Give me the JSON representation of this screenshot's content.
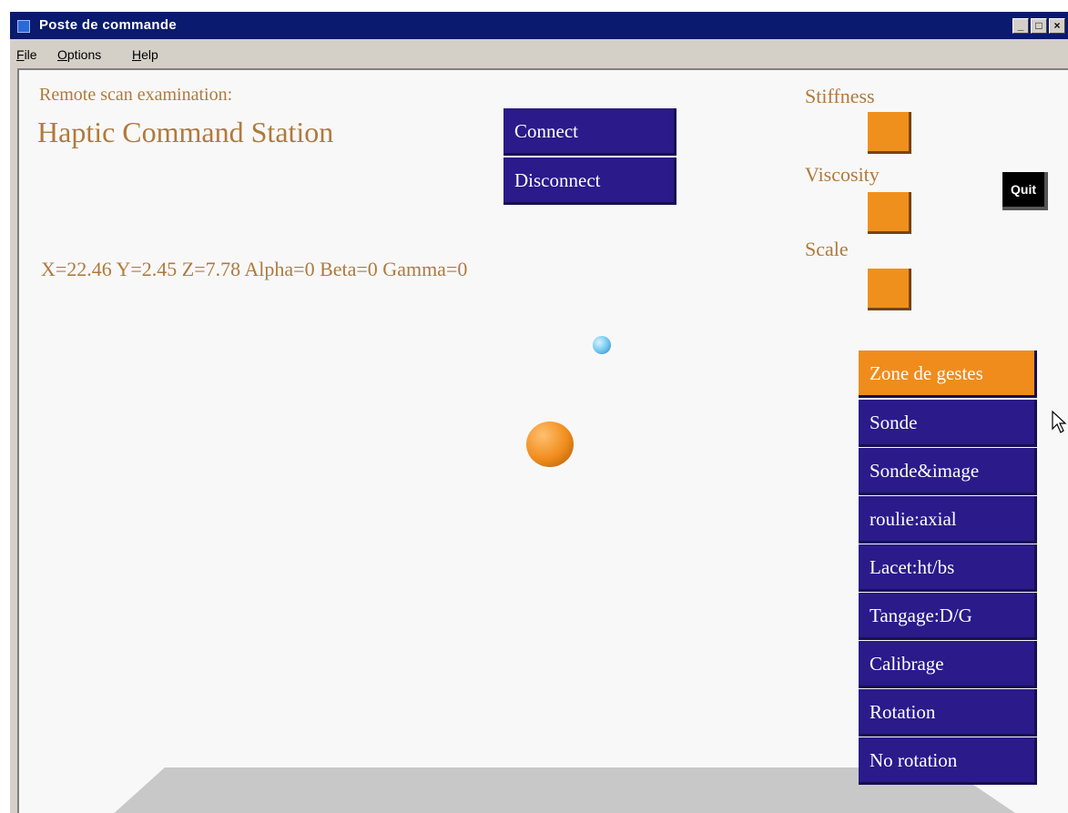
{
  "window": {
    "title": "Poste de commande"
  },
  "menu": {
    "file": "ile",
    "file_u": "F",
    "options": "ptions",
    "options_u": "O",
    "help": "elp",
    "help_u": "H"
  },
  "scene": {
    "subtitle": "Remote scan examination:",
    "title": "Haptic Command Station",
    "coords": "X=22.46 Y=2.45 Z=7.78 Alpha=0 Beta=0 Gamma=0",
    "connect_label": "Connect",
    "disconnect_label": "Disconnect",
    "stiffness_label": "Stiffness",
    "viscosity_label": "Viscosity",
    "scale_label": "Scale",
    "quit_label": "Quit",
    "modes": [
      {
        "label": "Zone de gestes",
        "active": true
      },
      {
        "label": "Sonde",
        "active": false
      },
      {
        "label": "Sonde&image",
        "active": false
      },
      {
        "label": "roulie:axial",
        "active": false
      },
      {
        "label": "Lacet:ht/bs",
        "active": false
      },
      {
        "label": "Tangage:D/G",
        "active": false
      },
      {
        "label": "Calibrage",
        "active": false
      },
      {
        "label": "Rotation",
        "active": false
      },
      {
        "label": "No rotation",
        "active": false
      }
    ]
  },
  "colors": {
    "accent_purple": "#2a1a8a",
    "accent_orange": "#f08c1c",
    "label_text": "#b07a3c",
    "titlebar": "#0a1a6e"
  }
}
